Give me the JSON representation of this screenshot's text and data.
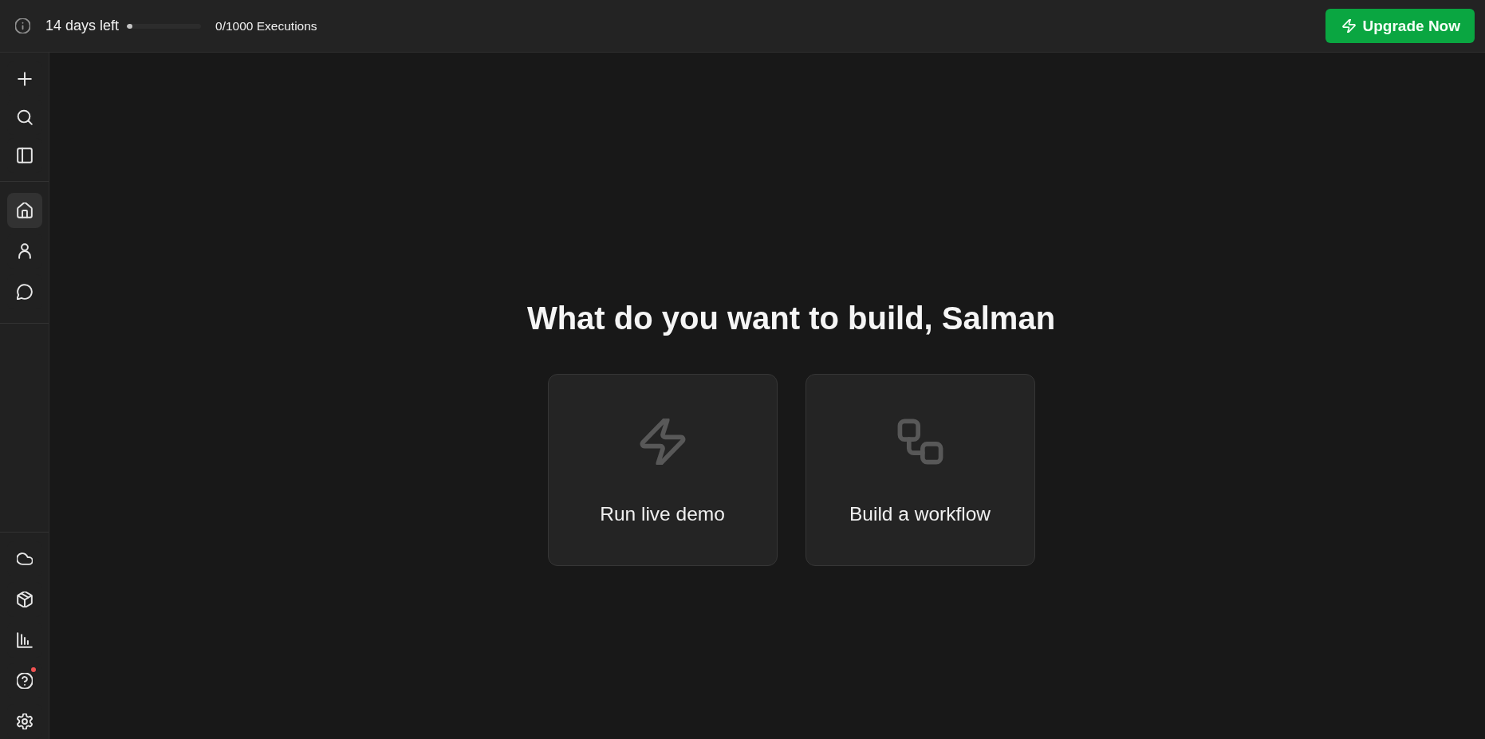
{
  "top_bar": {
    "trial": {
      "days_left": "14 days left",
      "level": 0.07,
      "executions": "0/1000 Executions"
    },
    "upgrade_button": {
      "label": "Upgrade Now"
    }
  },
  "sidebar": {
    "groups": [
      {
        "items": [
          {
            "kind": "plus",
            "selected": false
          },
          {
            "kind": "search",
            "selected": false
          },
          {
            "kind": "panel",
            "selected": false
          }
        ]
      },
      {
        "items": [
          {
            "kind": "home",
            "selected": true
          },
          {
            "kind": "user",
            "selected": false
          },
          {
            "kind": "chat",
            "selected": false
          }
        ]
      },
      {
        "items": [
          {
            "kind": "cloud",
            "selected": false
          },
          {
            "kind": "box",
            "selected": false
          },
          {
            "kind": "chart",
            "selected": false
          },
          {
            "kind": "help",
            "selected": false,
            "notification": true
          },
          {
            "kind": "gear",
            "selected": false
          }
        ]
      }
    ]
  },
  "main": {
    "heading": "What do you want to build, Salman",
    "cards": [
      {
        "kind": "bolt",
        "label": "Run live demo"
      },
      {
        "kind": "workflow",
        "label": "Build a workflow"
      }
    ]
  }
}
